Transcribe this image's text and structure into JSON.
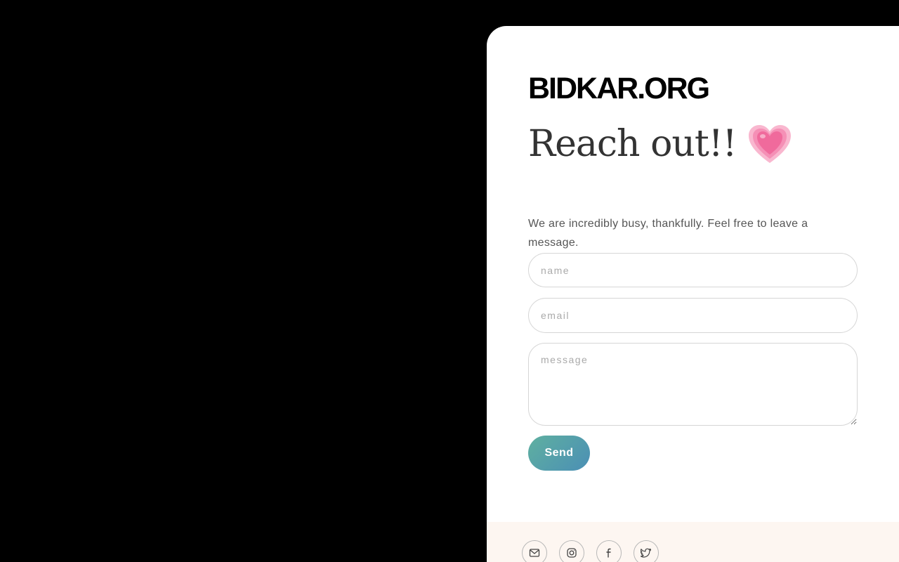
{
  "brand": {
    "logo_text": "BIDKAR.ORG"
  },
  "hero": {
    "heading": "Reach out!!",
    "heading_icon": "growing-heart-icon",
    "intro": "We are incredibly busy, thankfully. Feel free to leave a message."
  },
  "form": {
    "name_placeholder": "name",
    "name_value": "",
    "email_placeholder": "email",
    "email_value": "",
    "message_placeholder": "message",
    "message_value": "",
    "send_label": "Send"
  },
  "footer": {
    "socials": [
      {
        "icon": "mail-icon"
      },
      {
        "icon": "instagram-icon"
      },
      {
        "icon": "facebook-icon"
      },
      {
        "icon": "twitter-icon"
      }
    ]
  },
  "colors": {
    "background": "#000000",
    "panel": "#ffffff",
    "footer": "#fdf6f1",
    "button_gradient_start": "#5fb0a0",
    "button_gradient_end": "#4b8fb5",
    "heart": "#f06a9c"
  }
}
